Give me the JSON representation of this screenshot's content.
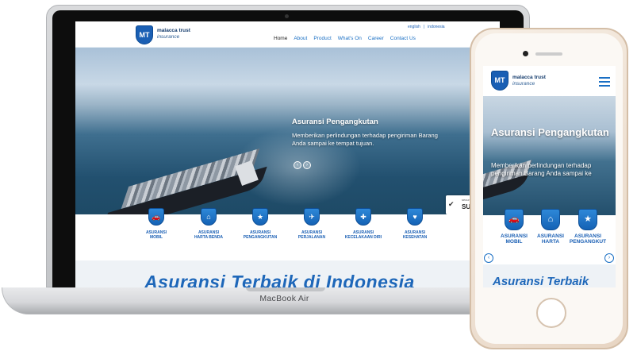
{
  "brand": {
    "logo_text": "MT",
    "name": "malacca trust",
    "sub": "insurance"
  },
  "laptop": {
    "model_label": "MacBook Air"
  },
  "desktop": {
    "lang_english": "english",
    "lang_sep": "|",
    "lang_indonesia": "indonesia",
    "nav": [
      "Home",
      "About",
      "Product",
      "What's On",
      "Career",
      "Contact Us"
    ],
    "hero_title": "Asuransi Pengangkutan",
    "hero_desc": "Memberikan perlindungan terhadap pengiriman Barang Anda sampai ke tempat tujuan.",
    "badge_small": "secured",
    "badge_big": "SUCU",
    "products": [
      {
        "icon": "car-icon",
        "glyph": "🚗",
        "label_1": "ASURANSI",
        "label_2": "MOBIL"
      },
      {
        "icon": "house-icon",
        "glyph": "⌂",
        "label_1": "ASURANSI",
        "label_2": "HARTA BENDA"
      },
      {
        "icon": "box-icon",
        "glyph": "★",
        "label_1": "ASURANSI",
        "label_2": "PENGANGKUTAN"
      },
      {
        "icon": "plane-icon",
        "glyph": "✈",
        "label_1": "ASURANSI",
        "label_2": "PERJALANAN"
      },
      {
        "icon": "injury-icon",
        "glyph": "✚",
        "label_1": "ASURANSI",
        "label_2": "KECELAKAAN DIRI"
      },
      {
        "icon": "stethoscope-icon",
        "glyph": "♥",
        "label_1": "ASURANSI",
        "label_2": "KESEHATAN"
      }
    ],
    "tagline": "Asuransi Terbaik di Indonesia"
  },
  "mobile": {
    "hero_title": "Asuransi Pengangkutan",
    "hero_desc": "Memberikan perlindungan terhadap pengiriman Barang Anda sampai ke",
    "products": [
      {
        "icon": "car-icon",
        "glyph": "🚗",
        "label_1": "ASURANSI",
        "label_2": "MOBIL"
      },
      {
        "icon": "house-icon",
        "glyph": "⌂",
        "label_1": "ASURANSI",
        "label_2": "HARTA"
      },
      {
        "icon": "box-icon",
        "glyph": "★",
        "label_1": "ASURANSI",
        "label_2": "PENGANGKUT"
      }
    ],
    "tagline": "Asuransi Terbaik"
  },
  "colors": {
    "accent": "#1a6fc4",
    "brand_dark": "#1a5fb4"
  }
}
